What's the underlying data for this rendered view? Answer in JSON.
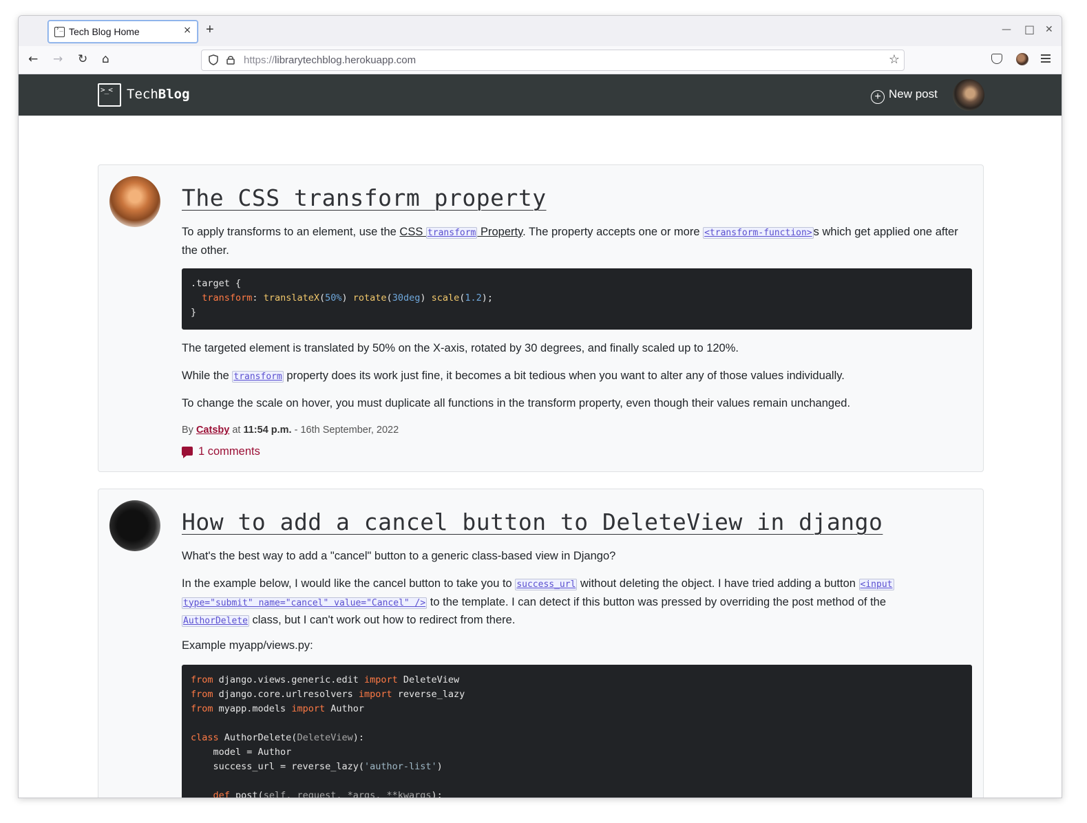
{
  "browser": {
    "tab_title": "Tech Blog Home",
    "tab_close": "×",
    "new_tab": "+",
    "url_scheme": "https://",
    "url_host": "librarytechblog.herokuapp.com",
    "controls": {
      "minimize": "—",
      "maximize": "□",
      "close": "✕"
    },
    "nav": {
      "back": "←",
      "forward": "→",
      "reload": "↻",
      "home": "⌂",
      "bookmark": "☆"
    }
  },
  "site": {
    "brand_plain": "Tech",
    "brand_bold": "Blog",
    "new_post_label": "New post",
    "new_post_icon": "+"
  },
  "posts": [
    {
      "title": "The CSS transform property",
      "p1_a": "To apply transforms to an element, use the ",
      "p1_link_a": "CSS ",
      "p1_link_code": "transform",
      "p1_link_b": " Property",
      "p1_b": ". The property accepts one or more ",
      "p1_code": "<transform-function>",
      "p1_c": "s which get applied one after the other.",
      "code_line1": ".target {",
      "code_prop": "transform",
      "code_colon": ": ",
      "code_fn1": "translateX",
      "code_arg1": "50%",
      "code_fn2": "rotate",
      "code_arg2": "30deg",
      "code_fn3": "scale",
      "code_arg3": "1.2",
      "code_end": "}",
      "p2": "The targeted element is translated by 50% on the X-axis, rotated by 30 degrees, and finally scaled up to 120%.",
      "p3_a": "While the ",
      "p3_code": "transform",
      "p3_b": " property does its work just fine, it becomes a bit tedious when you want to alter any of those values individually.",
      "p4": "To change the scale on hover, you must duplicate all functions in the transform property, even though their values remain unchanged.",
      "meta_by": "By ",
      "author": "Catsby",
      "meta_at": " at ",
      "time": "11:54 p.m.",
      "date": " - 16th September, 2022",
      "comments": "1 comments"
    },
    {
      "title": "How to add a cancel button to DeleteView in django",
      "p1": "What's the best way to add a \"cancel\" button to a generic class-based view in Django?",
      "p2_a": "In the example below, I would like the cancel button to take you to ",
      "p2_code1": "success_url",
      "p2_b": " without deleting the object. I have tried adding a button ",
      "p2_code2a": "<input",
      "p2_code2b": "type=\"submit\" name=\"cancel\" value=\"Cancel\" />",
      "p2_c": " to the template. I can detect if this button was pressed by overriding the post method of the ",
      "p2_code3": "AuthorDelete",
      "p2_d": " class, but I can't work out how to redirect from there.",
      "p3": "Example myapp/views.py:",
      "code": {
        "from": "from",
        "import": "import",
        "class": "class",
        "def": "def",
        "l1_mod": " django.views.generic.edit ",
        "l1_name": " DeleteView",
        "l2_mod": " django.core.urlresolvers ",
        "l2_name": " reverse_lazy",
        "l3_mod": " myapp.models ",
        "l3_name": " Author",
        "l5_name": " AuthorDelete(",
        "l5_base": "DeleteView",
        "l5_end": "):",
        "l6": "    model = Author",
        "l7_a": "    success_url = reverse_lazy(",
        "l7_str": "'author-list'",
        "l7_end": ")",
        "l9_name": " post(",
        "l9_args": "self, request, *args, **kwargs",
        "l9_end": "):"
      }
    }
  ]
}
